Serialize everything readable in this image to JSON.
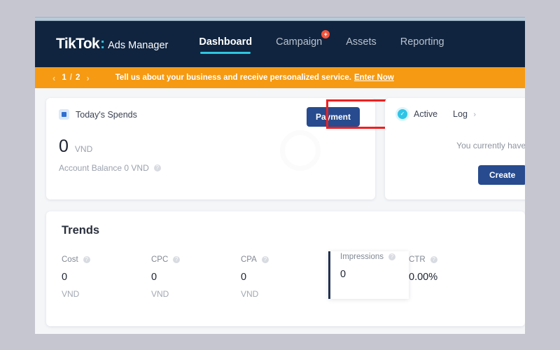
{
  "app": {
    "window_title": "TikTok Ads Manager Dashboard"
  },
  "topnav": {
    "brand_word": "TikTok",
    "brand_colon": ":",
    "brand_sub": "Ads Manager",
    "items": [
      {
        "label": "Dashboard",
        "active": true,
        "badge": ""
      },
      {
        "label": "Campaign",
        "active": false,
        "badge": "+"
      },
      {
        "label": "Assets",
        "active": false,
        "badge": ""
      },
      {
        "label": "Reporting",
        "active": false,
        "badge": ""
      }
    ]
  },
  "promo_banner": {
    "prev_arrow": "‹",
    "page_current": "1",
    "page_separator": "/",
    "page_total": "2",
    "next_arrow": "›",
    "message": "Tell us about your business and receive personalized service.",
    "link_label": "Enter Now",
    "background_color": "#f59a12"
  },
  "spends_card": {
    "icon_name": "spends-square-icon",
    "title": "Today's Spends",
    "payment_button_label": "Payment",
    "payment_button_color": "#274b8e",
    "annotation_color": "#f01f1f",
    "amount_value": "0",
    "amount_unit": "VND",
    "balance_text": "Account Balance 0 VND",
    "help_glyph": "?"
  },
  "account_card": {
    "status_label": "Active",
    "status_color": "#2ec4e6",
    "status_check": "✓",
    "log_label": "Log",
    "log_chevron": "›",
    "empty_text": "You currently have no a",
    "create_button_label": "Create",
    "create_button_color": "#274b8e"
  },
  "trends": {
    "title": "Trends",
    "help_glyph": "?",
    "metrics": [
      {
        "label": "Cost",
        "value": "0",
        "unit": "VND",
        "selected": false
      },
      {
        "label": "CPC",
        "value": "0",
        "unit": "VND",
        "selected": false
      },
      {
        "label": "CPA",
        "value": "0",
        "unit": "VND",
        "selected": false
      },
      {
        "label": "Impressions",
        "value": "0",
        "unit": "",
        "selected": true
      },
      {
        "label": "CTR",
        "value": "0.00%",
        "unit": "",
        "selected": false
      }
    ]
  }
}
